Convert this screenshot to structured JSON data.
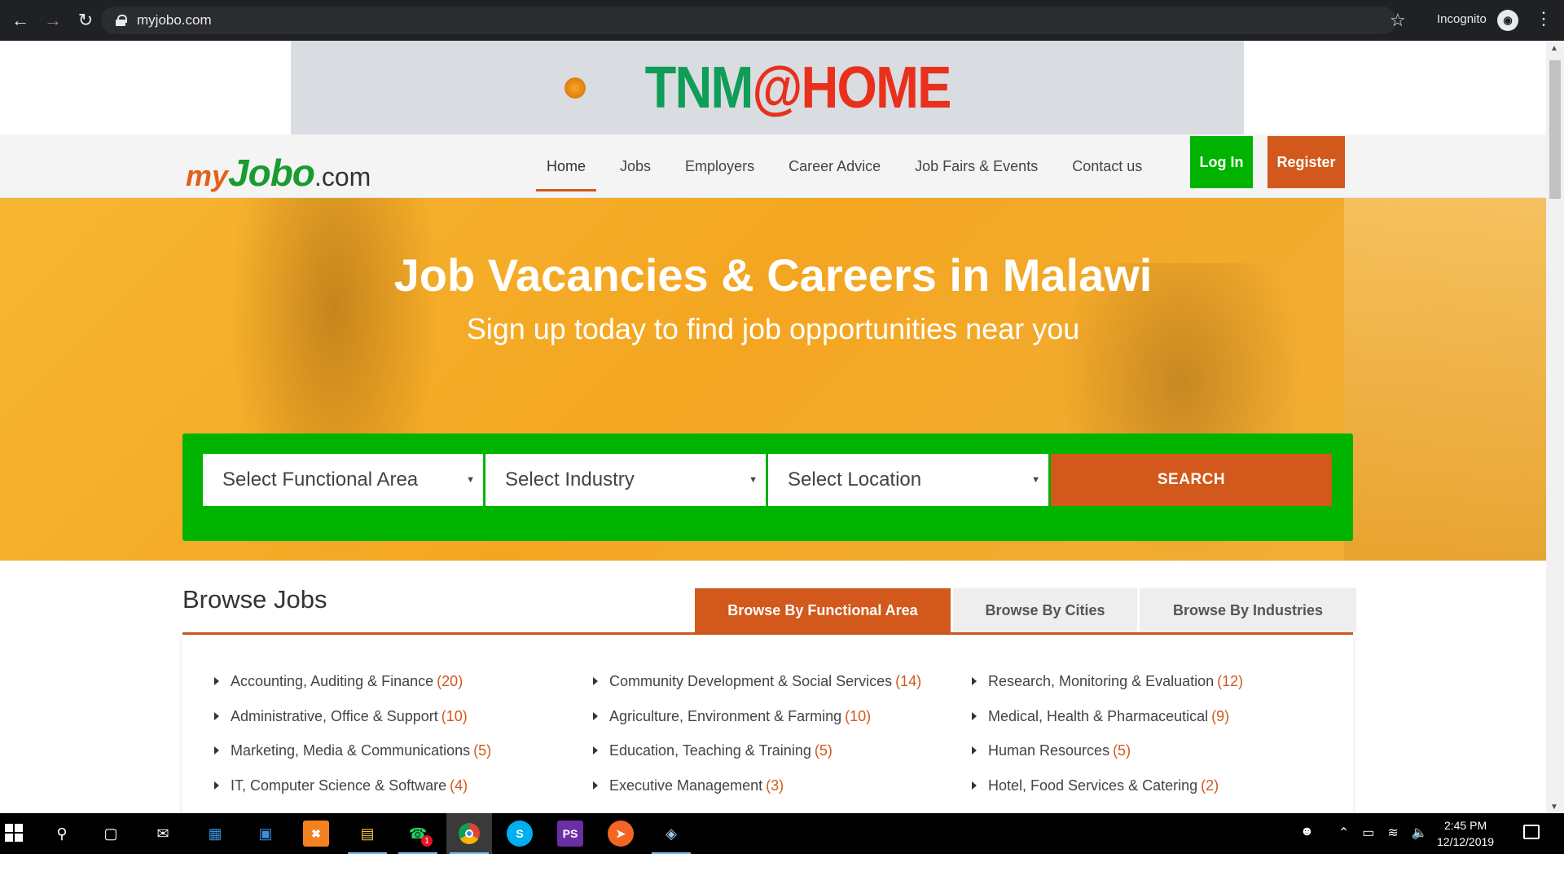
{
  "browser": {
    "url": "myjobo.com",
    "profile_label": "Incognito"
  },
  "ad": {
    "text_tnm": "TNM",
    "text_home": "@HOME"
  },
  "header": {
    "logo_my": "my",
    "logo_jobo": "Jobo",
    "logo_com": ".com",
    "nav": [
      "Home",
      "Jobs",
      "Employers",
      "Career Advice",
      "Job Fairs & Events",
      "Contact us"
    ],
    "active_nav": "Home",
    "login_label": "Log In",
    "register_label": "Register"
  },
  "hero": {
    "title": "Job Vacancies & Careers in Malawi",
    "subtitle": "Sign up today to find job opportunities near you",
    "functional_area_select": "Select Functional Area",
    "industry_select": "Select Industry",
    "location_select": "Select Location",
    "search_label": "SEARCH"
  },
  "browse": {
    "title": "Browse Jobs",
    "tabs": [
      "Browse By Functional Area",
      "Browse By Cities",
      "Browse By Industries"
    ],
    "active_tab": "Browse By Functional Area",
    "columns": [
      [
        {
          "label": "Accounting, Auditing & Finance",
          "count": "(20)"
        },
        {
          "label": "Administrative, Office & Support",
          "count": "(10)"
        },
        {
          "label": "Marketing, Media & Communications",
          "count": "(5)"
        },
        {
          "label": "IT, Computer Science & Software",
          "count": "(4)"
        }
      ],
      [
        {
          "label": "Community Development & Social Services",
          "count": "(14)"
        },
        {
          "label": "Agriculture, Environment & Farming",
          "count": "(10)"
        },
        {
          "label": "Education, Teaching & Training",
          "count": "(5)"
        },
        {
          "label": "Executive Management",
          "count": "(3)"
        }
      ],
      [
        {
          "label": "Research, Monitoring & Evaluation",
          "count": "(12)"
        },
        {
          "label": "Medical, Health & Pharmaceutical",
          "count": "(9)"
        },
        {
          "label": "Human Resources",
          "count": "(5)"
        },
        {
          "label": "Hotel, Food Services & Catering",
          "count": "(2)"
        }
      ]
    ]
  },
  "taskbar": {
    "time": "2:45 PM",
    "date": "12/12/2019",
    "whatsapp_badge": "1"
  },
  "colors": {
    "brand_orange": "#d2581c",
    "brand_green": "#00b300",
    "hero_yellow": "#f4a622"
  }
}
